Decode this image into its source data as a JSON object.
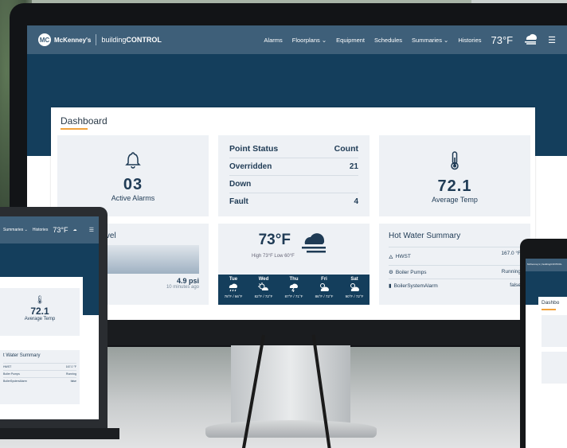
{
  "monitor": {
    "topbar": {
      "logo_badge": "MC",
      "brand": "McKenney's",
      "product_prefix": "building",
      "product_bold": "CONTROL",
      "nav": [
        {
          "label": "Alarms"
        },
        {
          "label": "Floorplans ⌄"
        },
        {
          "label": "Equipment"
        },
        {
          "label": "Schedules"
        },
        {
          "label": "Summaries ⌄"
        },
        {
          "label": "Histories"
        }
      ],
      "temp": "73°F",
      "menu_icon": "hamburger-icon",
      "weather_icon": "cloud-fog-icon"
    },
    "dashboard": {
      "title": "Dashboard",
      "alarms": {
        "count": "03",
        "label": "Active Alarms",
        "icon": "bell-icon"
      },
      "point_status": {
        "header_left": "Point Status",
        "header_right": "Count",
        "rows": [
          {
            "name": "Overridden",
            "count": "21"
          },
          {
            "name": "Down",
            "count": ""
          },
          {
            "name": "Fault",
            "count": "4"
          }
        ]
      },
      "avg_temp": {
        "value": "72.1",
        "label": "Average Temp",
        "icon": "thermometer-icon"
      },
      "storage": {
        "title": "Storage Level",
        "value": "4.9 psi",
        "time": "10 minutes ago"
      },
      "weather": {
        "temp": "73°F",
        "high_low": "High 73°F Low 60°F",
        "days": [
          {
            "day": "Tue",
            "icon": "rain-icon",
            "range": "78°F / 66°F"
          },
          {
            "day": "Wed",
            "icon": "sun-cloud-icon",
            "range": "82°F / 72°F"
          },
          {
            "day": "Thu",
            "icon": "storm-icon",
            "range": "87°F / 71°F"
          },
          {
            "day": "Fri",
            "icon": "partly-cloudy-icon",
            "range": "86°F / 72°F"
          },
          {
            "day": "Sat",
            "icon": "partly-cloudy-icon",
            "range": "90°F / 72°F"
          }
        ]
      },
      "hot_water": {
        "title": "Hot Water Summary",
        "rows": [
          {
            "name": "HWST",
            "value": "167.0 °F",
            "icon": "flame-icon"
          },
          {
            "name": "Boiler Pumps",
            "value": "Running",
            "icon": "pump-icon"
          },
          {
            "name": "BoilerSystemAlarm",
            "value": "false",
            "icon": "alarm-icon"
          }
        ]
      }
    }
  },
  "laptop": {
    "nav": [
      "Summaries ⌄",
      "Histories"
    ],
    "temp": "73°F",
    "avg_temp": {
      "value": "72.1",
      "label": "Average Temp"
    },
    "hot_water": {
      "title": "t Water Summary",
      "rows": [
        {
          "name": "HWST",
          "value": "167.0 °F"
        },
        {
          "name": "Boiler Pumps",
          "value": "Running"
        },
        {
          "name": "BoilerSystemAlarm",
          "value": "false"
        }
      ]
    }
  },
  "tablet": {
    "bar_text": "McKenney's | buildingCONTROL",
    "title": "Dashbo"
  },
  "colors": {
    "nav_bar": "#3e5f79",
    "header_band": "#143e5c",
    "accent": "#f2a23c",
    "card_bg": "#eef1f5",
    "text_dark": "#1f3b55"
  }
}
